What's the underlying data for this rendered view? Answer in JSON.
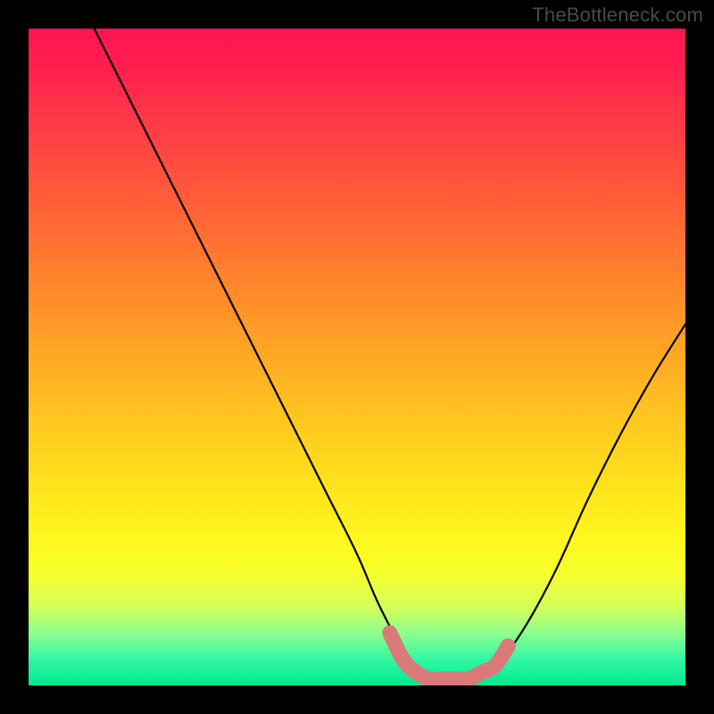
{
  "watermark": "TheBottleneck.com",
  "chart_data": {
    "type": "line",
    "title": "",
    "xlabel": "",
    "ylabel": "",
    "xlim": [
      0,
      100
    ],
    "ylim": [
      0,
      100
    ],
    "series": [
      {
        "name": "bottleneck-curve",
        "x": [
          10,
          15,
          20,
          25,
          30,
          35,
          40,
          45,
          50,
          53,
          56,
          58,
          60,
          62,
          64,
          66,
          68,
          71,
          75,
          80,
          85,
          90,
          95,
          100
        ],
        "values": [
          100,
          90,
          80,
          70,
          60,
          50,
          40,
          30,
          20,
          13,
          7,
          3,
          1,
          0,
          0,
          0,
          1,
          3,
          8,
          17,
          28,
          38,
          47,
          55
        ]
      }
    ],
    "highlight_region": {
      "name": "optimal-zone",
      "color": "#d97a78",
      "x": [
        55,
        57,
        59,
        61,
        63,
        65,
        67,
        69,
        71,
        73
      ],
      "values": [
        8,
        4,
        2,
        1,
        1,
        1,
        1,
        2,
        3,
        6
      ]
    },
    "gradient_stops": [
      {
        "pos": 0,
        "color": "#ff1452"
      },
      {
        "pos": 30,
        "color": "#ff6a34"
      },
      {
        "pos": 60,
        "color": "#ffc81f"
      },
      {
        "pos": 85,
        "color": "#f6ff2d"
      },
      {
        "pos": 100,
        "color": "#00e890"
      }
    ]
  }
}
